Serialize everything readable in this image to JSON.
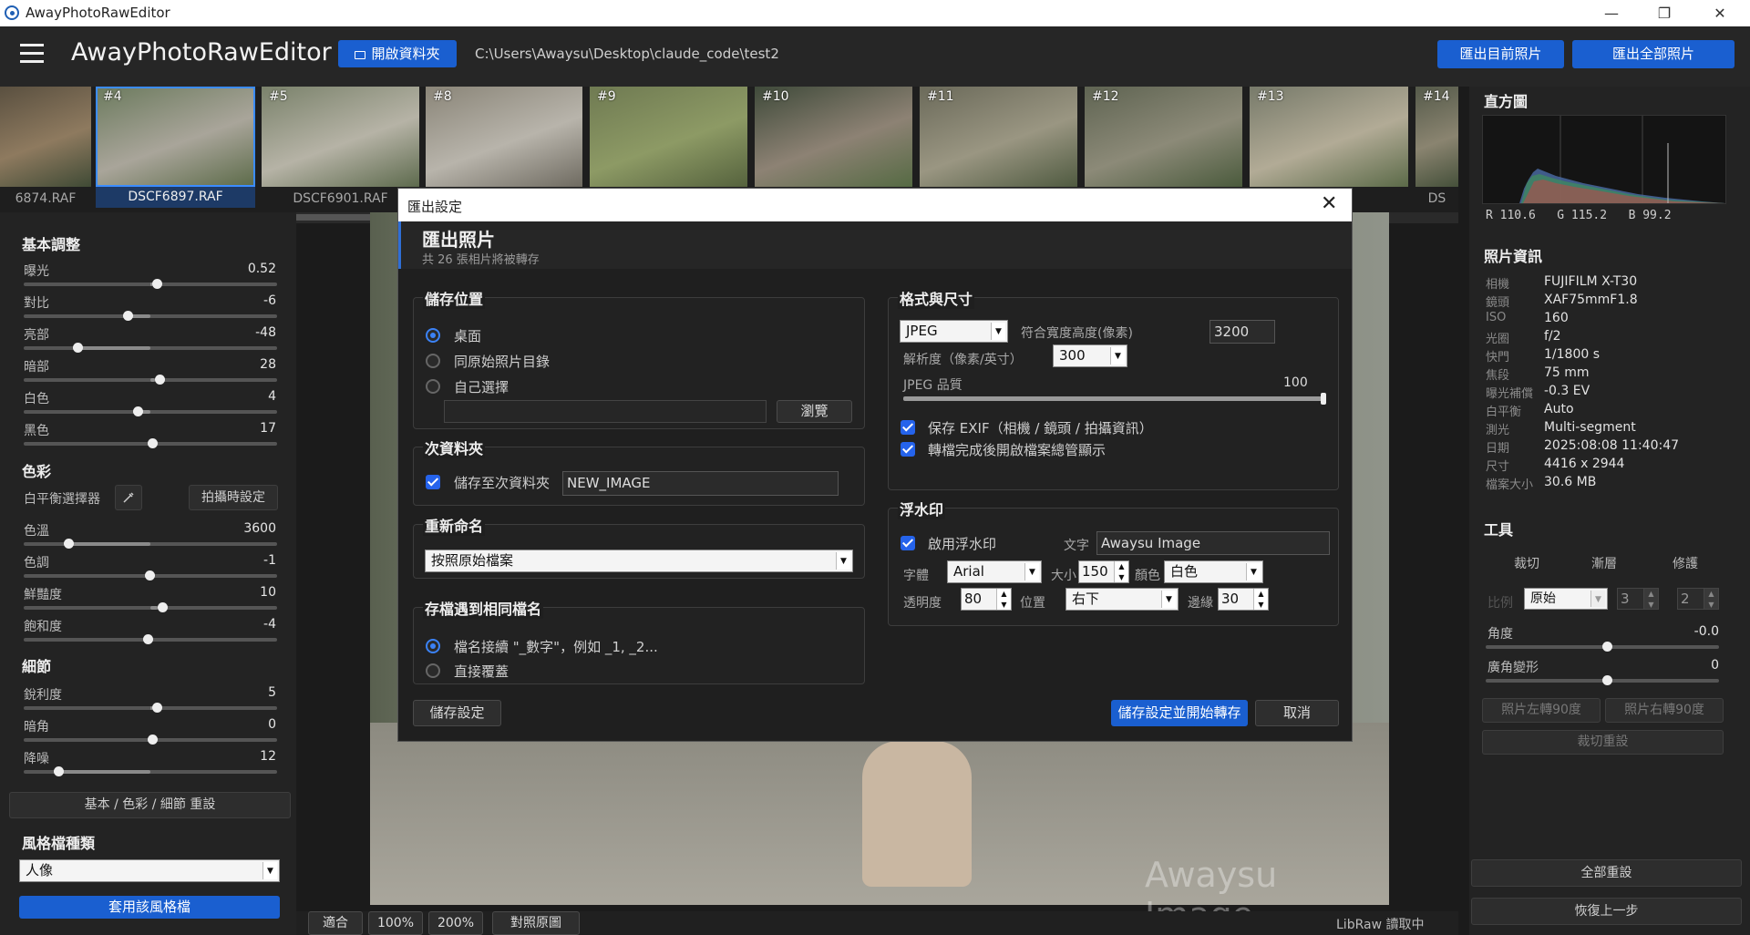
{
  "window": {
    "title": "AwayPhotoRawEditor",
    "minimize": "—",
    "restore": "❐",
    "close": "✕"
  },
  "header": {
    "app_title": "AwayPhotoRawEditor",
    "open_folder": "開啟資料夾",
    "path": "C:\\Users\\Awaysu\\Desktop\\claude_code\\test2",
    "export_current": "匯出目前照片",
    "export_all": "匯出全部照片"
  },
  "filmstrip": [
    {
      "num": "",
      "caption": "6874.RAF",
      "colors": [
        "#5a5040",
        "#8e7a5f",
        "#3f4a35"
      ]
    },
    {
      "num": "#4",
      "caption": "DSCF6897.RAF",
      "colors": [
        "#6b7a5d",
        "#a9a59a",
        "#5b6a48"
      ],
      "selected": true
    },
    {
      "num": "#5",
      "caption": "DSCF6901.RAF",
      "colors": [
        "#7a826b",
        "#b6b3a6",
        "#5d6a4d"
      ]
    },
    {
      "num": "#8",
      "caption": "",
      "colors": [
        "#8a8578",
        "#b8b4ab",
        "#6e6a60"
      ]
    },
    {
      "num": "#9",
      "caption": "",
      "colors": [
        "#6f7a52",
        "#8d9a65",
        "#55623d"
      ]
    },
    {
      "num": "#10",
      "caption": "",
      "colors": [
        "#3f4a3a",
        "#8d8274",
        "#556a43"
      ]
    },
    {
      "num": "#11",
      "caption": "",
      "colors": [
        "#6b6a5a",
        "#9a9682",
        "#4f5a40"
      ]
    },
    {
      "num": "#12",
      "caption": "",
      "colors": [
        "#5f6452",
        "#8c8a78",
        "#4a5a3c"
      ]
    },
    {
      "num": "#13",
      "caption": "",
      "colors": [
        "#777a6a",
        "#b2ab96",
        "#5b6a48"
      ]
    },
    {
      "num": "#14",
      "caption": "DS",
      "colors": [
        "#555a4a",
        "#8a8470",
        "#45503a"
      ]
    }
  ],
  "left": {
    "basic_title": "基本調整",
    "basic": [
      {
        "label": "曝光",
        "value": "0.52",
        "pos": 0.52
      },
      {
        "label": "對比",
        "value": "-6",
        "pos": 0.4
      },
      {
        "label": "亮部",
        "value": "-48",
        "pos": 0.2
      },
      {
        "label": "暗部",
        "value": "28",
        "pos": 0.53
      },
      {
        "label": "白色",
        "value": "4",
        "pos": 0.44
      },
      {
        "label": "黑色",
        "value": "17",
        "pos": 0.5
      }
    ],
    "color_title": "色彩",
    "wb_picker_label": "白平衡選擇器",
    "wb_shot": "拍攝時設定",
    "color": [
      {
        "label": "色溫",
        "value": "3600",
        "pos": 0.16
      },
      {
        "label": "色調",
        "value": "-1",
        "pos": 0.49
      },
      {
        "label": "鮮豔度",
        "value": "10",
        "pos": 0.54
      },
      {
        "label": "飽和度",
        "value": "-4",
        "pos": 0.48
      }
    ],
    "detail_title": "細節",
    "detail": [
      {
        "label": "銳利度",
        "value": "5",
        "pos": 0.52
      },
      {
        "label": "暗角",
        "value": "0",
        "pos": 0.5
      },
      {
        "label": "降噪",
        "value": "12",
        "pos": 0.12
      }
    ],
    "reset_btn": "基本 / 色彩 / 細節 重設",
    "style_title": "風格檔種類",
    "style_value": "人像",
    "apply_style": "套用該風格檔"
  },
  "status": {
    "fit": "適合",
    "z100": "100%",
    "z200": "200%",
    "compare": "對照原圖",
    "reading": "LibRaw 讀取中",
    "watermark": "Awaysu Image"
  },
  "right": {
    "hist_title": "直方圖",
    "hist_r": "R 110.6",
    "hist_g": "G 115.2",
    "hist_b": "B 99.2",
    "info_title": "照片資訊",
    "info": [
      {
        "k": "相機",
        "v": "FUJIFILM X-T30"
      },
      {
        "k": "鏡頭",
        "v": "XAF75mmF1.8"
      },
      {
        "k": "ISO",
        "v": "160"
      },
      {
        "k": "光圈",
        "v": "f/2"
      },
      {
        "k": "快門",
        "v": "1/1800 s"
      },
      {
        "k": "焦段",
        "v": "75 mm"
      },
      {
        "k": "曝光補償",
        "v": "-0.3 EV"
      },
      {
        "k": "白平衡",
        "v": "Auto"
      },
      {
        "k": "測光",
        "v": "Multi-segment"
      },
      {
        "k": "日期",
        "v": "2025:08:08 11:40:47"
      },
      {
        "k": "尺寸",
        "v": "4416 x 2944"
      },
      {
        "k": "檔案大小",
        "v": "30.6 MB"
      }
    ],
    "tools_title": "工具",
    "tool_crop": "裁切",
    "tool_grad": "漸層",
    "tool_heal": "修護",
    "ratio_label": "比例",
    "ratio_value": "原始",
    "ratio_w": "3",
    "ratio_h": "2",
    "angle_label": "角度",
    "angle_value": "-0.0",
    "lens_label": "廣角變形",
    "lens_value": "0",
    "rot_left": "照片左轉90度",
    "rot_right": "照片右轉90度",
    "crop_reset": "裁切重設",
    "reset_all": "全部重設",
    "undo": "恢復上一步"
  },
  "dialog": {
    "title": "匯出設定",
    "heading": "匯出照片",
    "sub": "共 26 張相片將被轉存",
    "save_loc": "儲存位置",
    "opt_desktop": "桌面",
    "opt_same": "同原始照片目錄",
    "opt_custom": "自己選擇",
    "browse": "瀏覽",
    "subfolder_title": "次資料夾",
    "subfolder_chk": "儲存至次資料夾",
    "subfolder_name": "NEW_IMAGE",
    "rename_title": "重新命名",
    "rename_value": "按照原始檔案",
    "dup_title": "存檔遇到相同檔名",
    "dup_opt1": "檔名接續 \"_數字\"，例如 _1, _2...",
    "dup_opt2": "直接覆蓋",
    "fmt_title": "格式與尺寸",
    "fmt_value": "JPEG",
    "fit_label": "符合寬度高度(像素)",
    "fit_value": "3200",
    "dpi_label": "解析度（像素/英寸）",
    "dpi_value": "300",
    "quality_label": "JPEG 品質",
    "quality_value": "100",
    "exif_chk": "保存 EXIF（相機 / 鏡頭 / 拍攝資訊）",
    "open_chk": "轉檔完成後開啟檔案總管顯示",
    "wm_title": "浮水印",
    "wm_enable": "啟用浮水印",
    "wm_text_label": "文字",
    "wm_text": "Awaysu Image",
    "font_label": "字體",
    "font_value": "Arial",
    "size_label": "大小",
    "size_value": "150",
    "color_label": "顏色",
    "color_value": "白色",
    "opacity_label": "透明度",
    "opacity_value": "80",
    "pos_label": "位置",
    "pos_value": "右下",
    "margin_label": "邊緣",
    "margin_value": "30",
    "save_settings": "儲存設定",
    "start": "儲存設定並開始轉存",
    "cancel": "取消"
  }
}
